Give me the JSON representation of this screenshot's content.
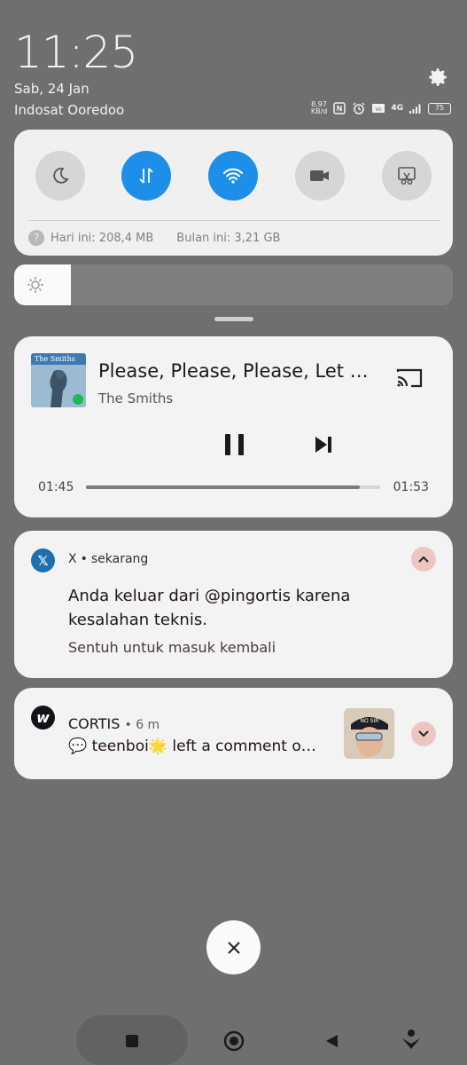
{
  "status": {
    "time": "11:25",
    "date": "Sab, 24 Jan",
    "carrier": "Indosat Ooredoo",
    "net_speed_value": "8,97",
    "net_speed_unit": "KB/d",
    "network_type": "4G",
    "battery": "75"
  },
  "quick_settings": {
    "tiles": [
      {
        "name": "do-not-disturb",
        "icon": "moon-icon",
        "on": false
      },
      {
        "name": "mobile-data",
        "icon": "data-arrows-icon",
        "on": true
      },
      {
        "name": "wifi",
        "icon": "wifi-icon",
        "on": true
      },
      {
        "name": "screen-record",
        "icon": "video-camera-icon",
        "on": false
      },
      {
        "name": "screenshot",
        "icon": "scissors-icon",
        "on": false
      }
    ],
    "usage_today": "Hari ini: 208,4 MB",
    "usage_month": "Bulan ini: 3,21 GB"
  },
  "brightness": {
    "level": 0.13
  },
  "media": {
    "album_band": "The Smiths",
    "track": "Please, Please, Please, Let Me Get What I Want",
    "artist": "The Smiths",
    "elapsed": "01:45",
    "total": "01:53",
    "progress": 0.93
  },
  "notifications": [
    {
      "app": "X",
      "time": "sekarang",
      "title": "Anda keluar dari @pingortis karena kesalahan teknis.",
      "subtitle": "Sentuh untuk masuk kembali"
    },
    {
      "app": "CORTIS",
      "time": "6 m",
      "body": "💬 teenboi🌟 left a comment o…",
      "thumb_text": "NO SIR"
    }
  ],
  "colors": {
    "accent": "#1e8fe8",
    "expand_bg": "#ecc7c2",
    "backdrop": "#6f6f6f"
  }
}
